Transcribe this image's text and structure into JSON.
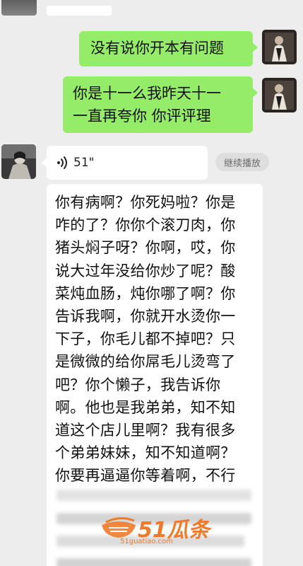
{
  "messages": [
    {
      "side": "right",
      "text": "没有说你开本有问题"
    },
    {
      "side": "right",
      "lines": [
        "你是十一么我昨天十一",
        "一直再夸你 你评评理"
      ]
    }
  ],
  "voice": {
    "duration": "51\"",
    "continue_label": "继续播放",
    "transcript_lines": [
      "你有病啊？你死妈啦？你是",
      "咋的了？你你个滚刀肉，你",
      "猪头焖子呀？你啊，哎，你",
      "说大过年没给你炒了呢？酸",
      "菜炖血肠，炖你哪了啊？你",
      "告诉我啊，你就开水烫你一",
      "下子，你毛儿都不掉吧？只",
      "是微微的给你屌毛儿烫弯了",
      "吧？你个懒子，我告诉你",
      "啊。他也是我弟弟，知不知",
      "道这个店儿里啊？我有很多",
      "个弟弟妹妹，知不知道啊？",
      "你要再逼逼你等着啊，不行"
    ]
  },
  "watermark": {
    "brand": "51瓜条",
    "sub": "51guatiao.com"
  },
  "colors": {
    "background": "#ededed",
    "sent_bubble": "#95ec69",
    "received_bubble": "#ffffff",
    "watermark": "#f07a2a"
  },
  "icons": {
    "voice": "voice-wave-icon",
    "watermark_logo": "bowl-logo-icon"
  }
}
